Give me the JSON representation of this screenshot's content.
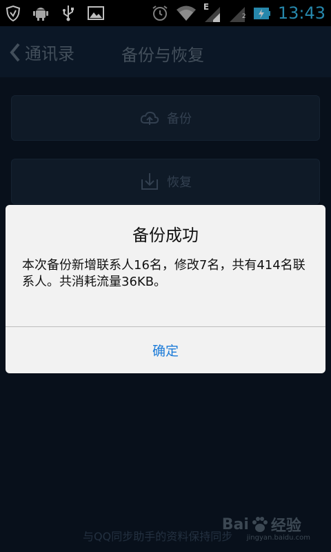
{
  "status_bar": {
    "time": "13:43",
    "icons": [
      "shield-icon",
      "android-icon",
      "usb-icon",
      "image-icon",
      "alarm-icon",
      "wifi-icon",
      "signal-e-icon",
      "signal-2-icon",
      "battery-charging-icon"
    ],
    "network_type": "E",
    "sim_index": "2",
    "time_color": "#33b5e5"
  },
  "appbar": {
    "back_label": "通讯录",
    "title": "备份与恢复"
  },
  "actions": {
    "backup_label": "备份",
    "restore_label": "恢复"
  },
  "footer": {
    "sync_text": "与QQ同步助手的资料保持同步"
  },
  "watermark": {
    "brand": "Bai",
    "brand2": "经验",
    "url": "jingyan.baidu.com"
  },
  "dialog": {
    "title": "备份成功",
    "message": "本次备份新增联系人16名，修改7名，共有414名联系人。共消耗流量36KB。",
    "ok_label": "确定",
    "ok_color": "#1a7ad8"
  }
}
